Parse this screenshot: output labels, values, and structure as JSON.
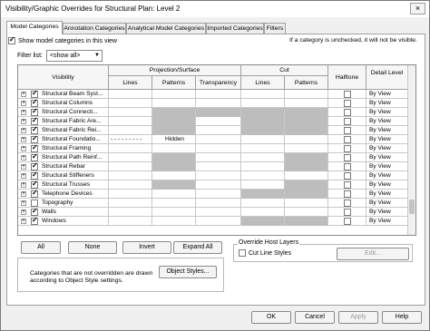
{
  "window": {
    "title": "Visibility/Graphic Overrides for Structural Plan: Level 2",
    "close_label": "×"
  },
  "tabs": [
    {
      "label": "Model Categories"
    },
    {
      "label": "Annotation Categories"
    },
    {
      "label": "Analytical Model Categories"
    },
    {
      "label": "Imported Categories"
    },
    {
      "label": "Filters"
    }
  ],
  "show_model_categories": {
    "label": "Show model categories in this view",
    "checked": true
  },
  "note": "If a category is unchecked, it will not be visible.",
  "filter": {
    "label": "Filter list:",
    "value": "<show all>"
  },
  "table": {
    "headers": {
      "visibility": "Visibility",
      "projection_surface": "Projection/Surface",
      "cut": "Cut",
      "halftone": "Halftone",
      "detail_level": "Detail Level",
      "lines": "Lines",
      "patterns": "Patterns",
      "transparency": "Transparency",
      "cut_lines": "Lines",
      "cut_patterns": "Patterns"
    },
    "rows": [
      {
        "name": "Structural Beam Syst...",
        "visible": true,
        "proj_lines": "",
        "proj_patterns": "",
        "transparency": "",
        "cut_lines": "",
        "cut_patterns": "",
        "halftone": false,
        "detail": "By View",
        "gray": []
      },
      {
        "name": "Structural Columns",
        "visible": true,
        "proj_lines": "",
        "proj_patterns": "",
        "transparency": "",
        "cut_lines": "",
        "cut_patterns": "",
        "halftone": false,
        "detail": "By View",
        "gray": []
      },
      {
        "name": "Structural Connecti...",
        "visible": true,
        "proj_lines": "",
        "proj_patterns": "",
        "transparency": "",
        "cut_lines": "",
        "cut_patterns": "",
        "halftone": false,
        "detail": "By View",
        "gray": [
          "pp",
          "tr",
          "cl",
          "cp"
        ]
      },
      {
        "name": "Structural Fabric Are...",
        "visible": true,
        "proj_lines": "",
        "proj_patterns": "",
        "transparency": "",
        "cut_lines": "",
        "cut_patterns": "",
        "halftone": false,
        "detail": "By View",
        "gray": [
          "pp",
          "cl",
          "cp"
        ]
      },
      {
        "name": "Structural Fabric Rei...",
        "visible": true,
        "proj_lines": "",
        "proj_patterns": "",
        "transparency": "",
        "cut_lines": "",
        "cut_patterns": "",
        "halftone": false,
        "detail": "By View",
        "gray": [
          "pp",
          "cl",
          "cp"
        ]
      },
      {
        "name": "Structural Foundatio...",
        "visible": true,
        "proj_lines": "- - - - - - - - -",
        "proj_patterns": "Hidden",
        "transparency": "",
        "cut_lines": "",
        "cut_patterns": "",
        "halftone": false,
        "detail": "By View",
        "gray": []
      },
      {
        "name": "Structural Framing",
        "visible": true,
        "proj_lines": "",
        "proj_patterns": "",
        "transparency": "",
        "cut_lines": "",
        "cut_patterns": "",
        "halftone": false,
        "detail": "By View",
        "gray": []
      },
      {
        "name": "Structural Path Reinf...",
        "visible": true,
        "proj_lines": "",
        "proj_patterns": "",
        "transparency": "",
        "cut_lines": "",
        "cut_patterns": "",
        "halftone": false,
        "detail": "By View",
        "gray": [
          "pp",
          "cp"
        ]
      },
      {
        "name": "Structural Rebar",
        "visible": true,
        "proj_lines": "",
        "proj_patterns": "",
        "transparency": "",
        "cut_lines": "",
        "cut_patterns": "",
        "halftone": false,
        "detail": "By View",
        "gray": [
          "pp",
          "cp"
        ]
      },
      {
        "name": "Structural Stiffeners",
        "visible": true,
        "proj_lines": "",
        "proj_patterns": "",
        "transparency": "",
        "cut_lines": "",
        "cut_patterns": "",
        "halftone": false,
        "detail": "By View",
        "gray": []
      },
      {
        "name": "Structural Trusses",
        "visible": true,
        "proj_lines": "",
        "proj_patterns": "",
        "transparency": "",
        "cut_lines": "",
        "cut_patterns": "",
        "halftone": false,
        "detail": "By View",
        "gray": [
          "pp",
          "cp"
        ]
      },
      {
        "name": "Telephone Devices",
        "visible": true,
        "proj_lines": "",
        "proj_patterns": "",
        "transparency": "",
        "cut_lines": "",
        "cut_patterns": "",
        "halftone": false,
        "detail": "By View",
        "gray": [
          "cl",
          "cp"
        ]
      },
      {
        "name": "Topography",
        "visible": false,
        "proj_lines": "",
        "proj_patterns": "",
        "transparency": "",
        "cut_lines": "",
        "cut_patterns": "",
        "halftone": false,
        "detail": "By View",
        "gray": []
      },
      {
        "name": "Walls",
        "visible": true,
        "proj_lines": "",
        "proj_patterns": "",
        "transparency": "",
        "cut_lines": "",
        "cut_patterns": "",
        "halftone": false,
        "detail": "By View",
        "gray": []
      },
      {
        "name": "Windows",
        "visible": true,
        "proj_lines": "",
        "proj_patterns": "",
        "transparency": "",
        "cut_lines": "",
        "cut_patterns": "",
        "halftone": false,
        "detail": "By View",
        "gray": [
          "cl",
          "cp"
        ]
      }
    ]
  },
  "buttons": {
    "all": "All",
    "none": "None",
    "invert": "Invert",
    "expand_all": "Expand All"
  },
  "override_host": {
    "title": "Override Host Layers",
    "cut_line_styles": "Cut Line Styles",
    "cut_line_styles_checked": false,
    "edit": "Edit..."
  },
  "info": {
    "text": "Categories that are not overridden are drawn according to Object Style settings.",
    "object_styles": "Object Styles..."
  },
  "footer": {
    "ok": "OK",
    "cancel": "Cancel",
    "apply": "Apply",
    "help": "Help"
  }
}
